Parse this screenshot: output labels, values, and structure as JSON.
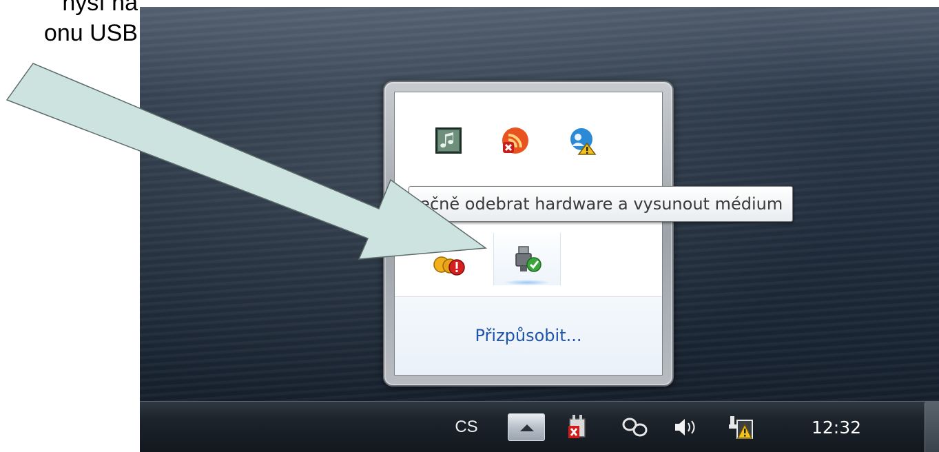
{
  "caption": {
    "line1": "nyší na",
    "line2": "onu USB"
  },
  "flyout": {
    "icons": [
      {
        "name": "music-app-icon"
      },
      {
        "name": "rss-error-icon"
      },
      {
        "name": "network-user-warning-icon"
      },
      {
        "name": "globe-icon"
      },
      {
        "name": "folder-icon"
      },
      {
        "name": "blue-app-icon"
      },
      {
        "name": "security-alert-icon"
      },
      {
        "name": "safely-remove-hardware-icon"
      }
    ],
    "customize_link": "Přizpůsobit..."
  },
  "tooltip": {
    "text": "nečně odebrat hardware a vysunout médium"
  },
  "taskbar": {
    "language": "CS",
    "clock": "12:32"
  },
  "colors": {
    "arrow_fill": "#cce3e0",
    "link": "#1e55a8",
    "taskbar": "#1c232b"
  }
}
